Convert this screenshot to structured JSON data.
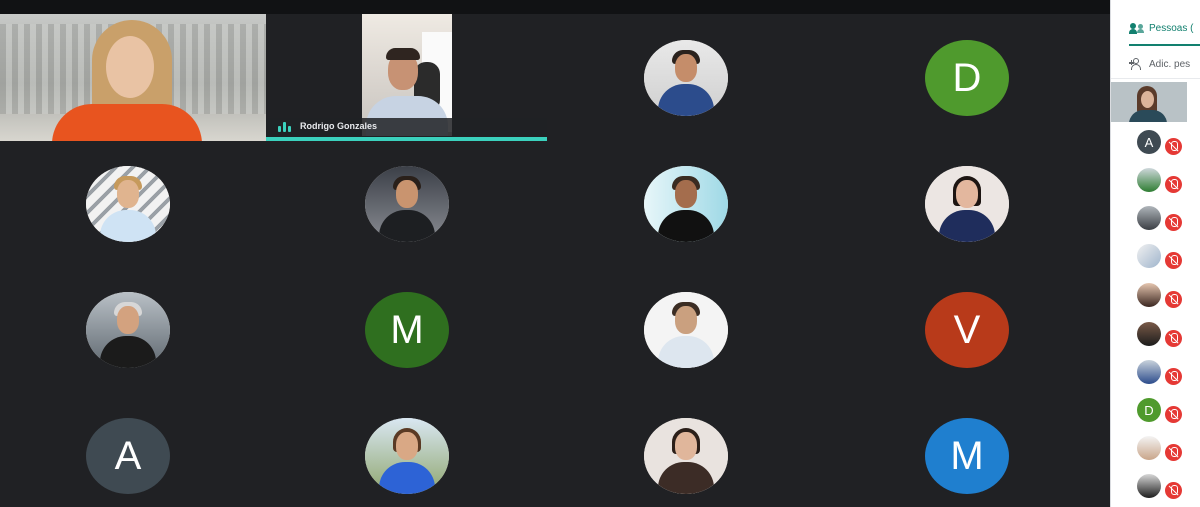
{
  "speaker_tile": {
    "name": "Rodrigo Gonzales"
  },
  "grid_avatars": [
    {
      "letter": "D",
      "color": "#4f9a2d"
    },
    {
      "letter": "M",
      "color": "#2f6f1f"
    },
    {
      "letter": "V",
      "color": "#b83a1a"
    },
    {
      "letter": "A",
      "color": "#3f4a52"
    },
    {
      "letter": "M",
      "color": "#1f7fcf"
    }
  ],
  "sidebar": {
    "people_tab_label": "Pessoas (",
    "add_people_label": "Adic. pes",
    "participants": [
      {
        "letter": "A",
        "color": "#3f4a52"
      },
      {
        "letter": "D",
        "color": "#4f9a2d"
      }
    ]
  }
}
